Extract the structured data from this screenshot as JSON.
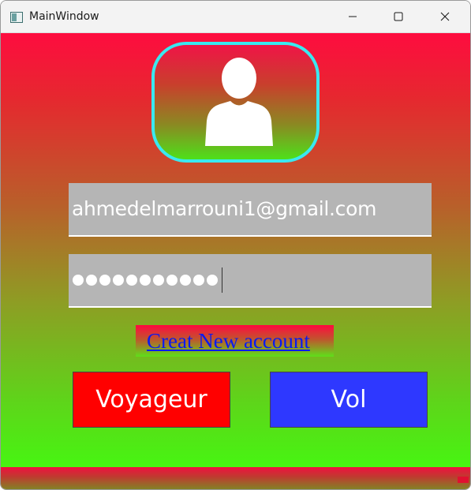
{
  "window": {
    "title": "MainWindow"
  },
  "login": {
    "email_value": "ahmedelmarrouni1@gmail.com",
    "password_masked_count": 11,
    "create_account_link": "Creat New account"
  },
  "buttons": {
    "voyageur_label": "Voyageur",
    "vol_label": "Vol"
  },
  "colors": {
    "gradient_top": "#fe0c3f",
    "gradient_bottom": "#47f512",
    "avatar_border": "#3ae8f0",
    "field_bg": "#b5b5b5",
    "link_color": "#0a1af0",
    "voyageur_bg": "#ff0000",
    "vol_bg": "#2e38ff"
  },
  "icons": {
    "avatar": "user-silhouette-icon",
    "minimize": "minimize-icon",
    "maximize": "maximize-icon",
    "close": "close-icon"
  }
}
